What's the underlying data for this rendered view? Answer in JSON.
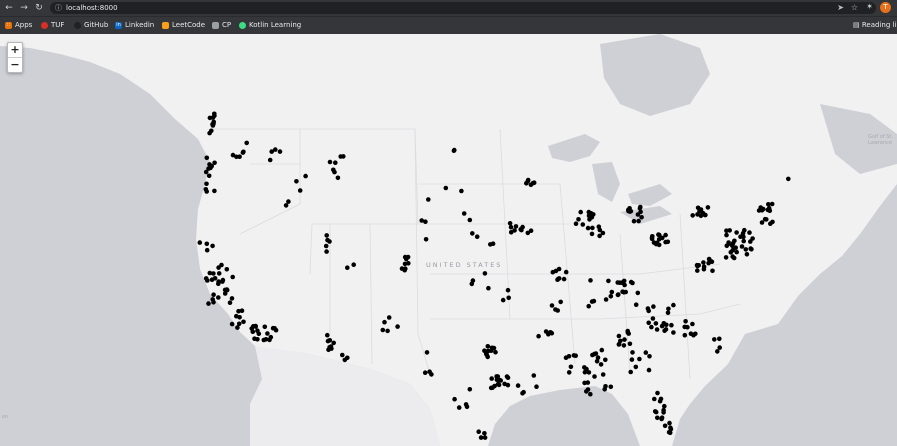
{
  "browser": {
    "url": "localhost:8000",
    "profile_initial": "T"
  },
  "bookmarks": [
    {
      "label": "Apps",
      "icon": "apps-grid-icon",
      "color": "#e8710a"
    },
    {
      "label": "TUF",
      "icon": "tuf-icon",
      "color": "#d93025"
    },
    {
      "label": "GitHub",
      "icon": "github-icon",
      "color": "#202124"
    },
    {
      "label": "Linkedin",
      "icon": "linkedin-icon",
      "color": "#0a66c2"
    },
    {
      "label": "LeetCode",
      "icon": "leetcode-icon",
      "color": "#f89f1b"
    },
    {
      "label": "CP",
      "icon": "folder-icon",
      "color": "#9aa0a6"
    },
    {
      "label": "Kotlin Learning",
      "icon": "kotlin-icon",
      "color": "#3ddc84"
    }
  ],
  "reading_list": "Reading li",
  "map": {
    "zoom_in": "+",
    "zoom_out": "−",
    "country_label": "UNITED STATES",
    "water_label": "Gulf of St. Lawrence",
    "edge_label": "on",
    "marker_color": "#000000"
  }
}
